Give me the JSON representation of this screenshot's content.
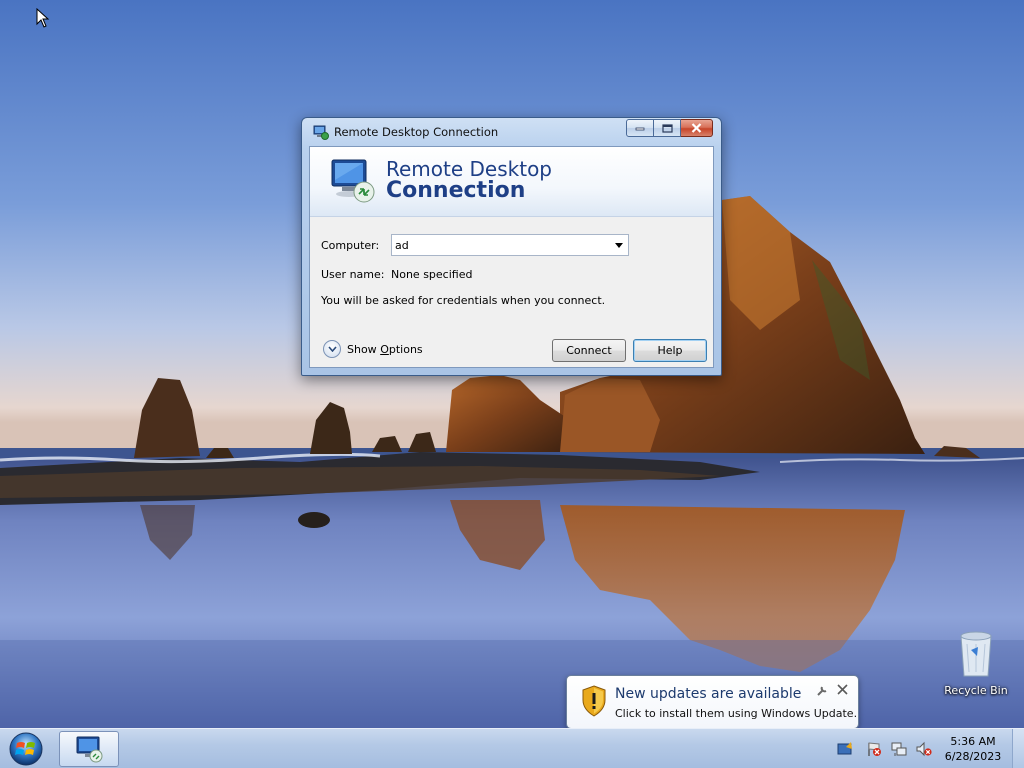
{
  "window": {
    "title": "Remote Desktop Connection",
    "banner_line1": "Remote Desktop",
    "banner_line2": "Connection",
    "computer_label": "Computer:",
    "computer_value": "ad",
    "username_label": "User name:",
    "username_value": "None specified",
    "info_text": "You will be asked for credentials when you connect.",
    "show_options_prefix": "Show ",
    "show_options_accel": "O",
    "show_options_suffix": "ptions",
    "connect_label": "Connect",
    "help_label": "Help"
  },
  "desktop": {
    "recycle_bin_label": "Recycle Bin"
  },
  "notification": {
    "title": "New updates are available",
    "body": "Click to install them using Windows Update."
  },
  "taskbar": {
    "time": "5:36 AM",
    "date": "6/28/2023"
  },
  "colors": {
    "banner_text": "#1e3f86",
    "titlebar": "#b9d1ee",
    "close_button": "#c7452a",
    "taskbar": "#b4c9e6"
  }
}
